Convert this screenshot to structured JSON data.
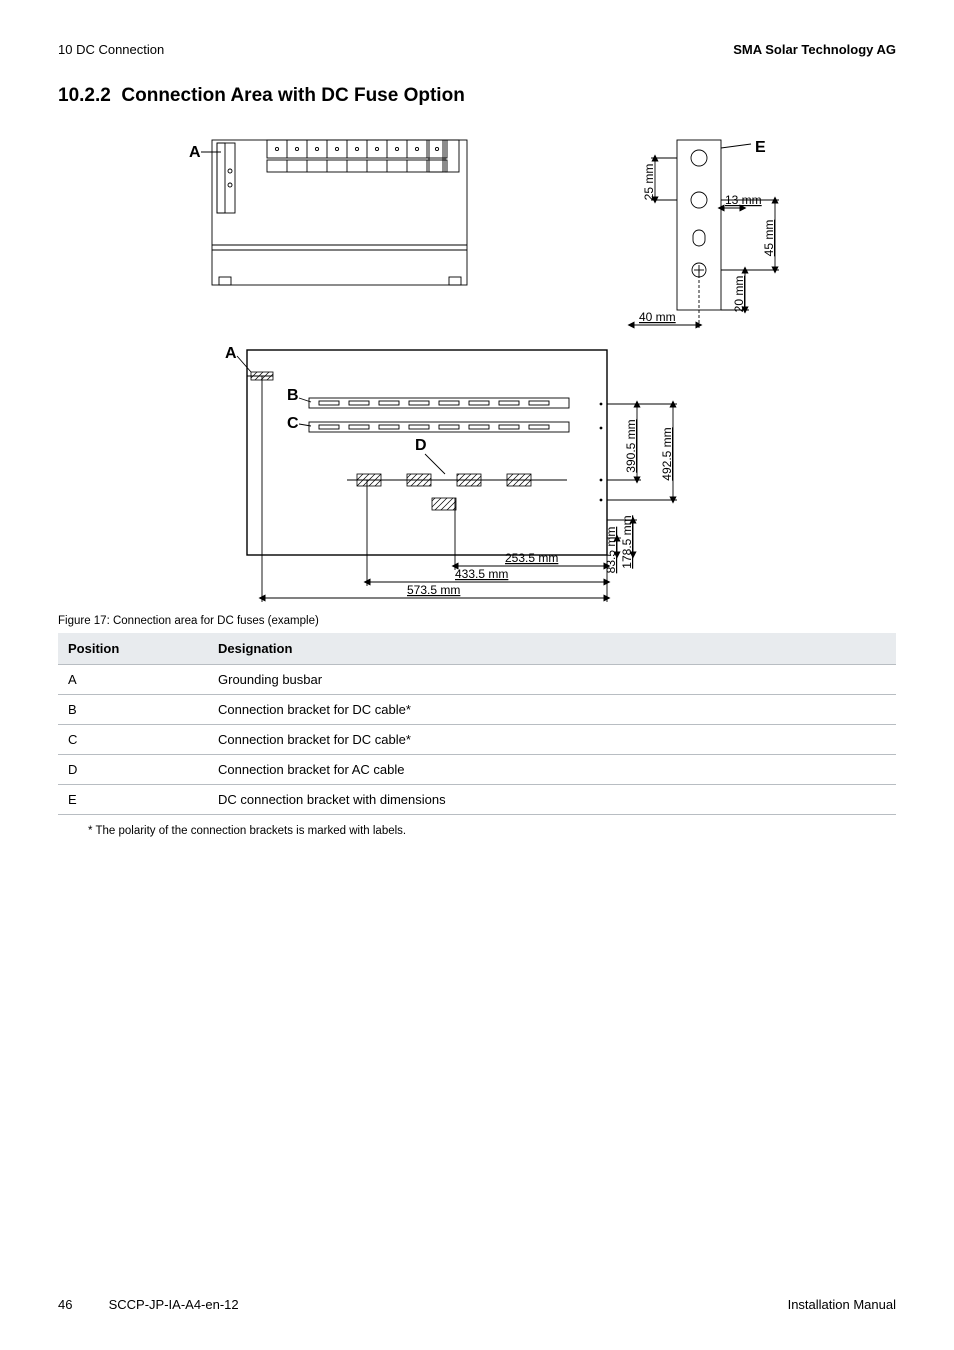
{
  "header": {
    "left": "10  DC Connection",
    "right": "SMA Solar Technology AG"
  },
  "section": {
    "number": "10.2.2",
    "title": "Connection Area with DC Fuse Option"
  },
  "figure": {
    "caption": "Figure 17:  Connection area for DC fuses (example)",
    "labels": {
      "A": "A",
      "A2": "A",
      "B": "B",
      "C": "C",
      "D": "D",
      "E": "E"
    },
    "dims": {
      "d25": "25 mm",
      "d13": "13 mm",
      "d45": "45 mm",
      "d40": "40 mm",
      "d20": "20 mm",
      "d390_5": "390.5 mm",
      "d492_5": "492.5 mm",
      "d253_5": "253.5 mm",
      "d433_5": "433.5 mm",
      "d573_5": "573.5 mm",
      "d83_5": "83.5 mm",
      "d178_5": "178.5 mm"
    }
  },
  "table": {
    "headers": {
      "pos": "Position",
      "des": "Designation"
    },
    "rows": [
      {
        "pos": "A",
        "des": "Grounding busbar"
      },
      {
        "pos": "B",
        "des": "Connection bracket for DC cable*"
      },
      {
        "pos": "C",
        "des": "Connection bracket for DC cable*"
      },
      {
        "pos": "D",
        "des": "Connection bracket for AC cable"
      },
      {
        "pos": "E",
        "des": "DC connection bracket with dimensions"
      }
    ]
  },
  "footnote": "* The polarity of the connection brackets is marked with labels.",
  "footer": {
    "page": "46",
    "doc": "SCCP-JP-IA-A4-en-12",
    "manual": "Installation Manual"
  }
}
